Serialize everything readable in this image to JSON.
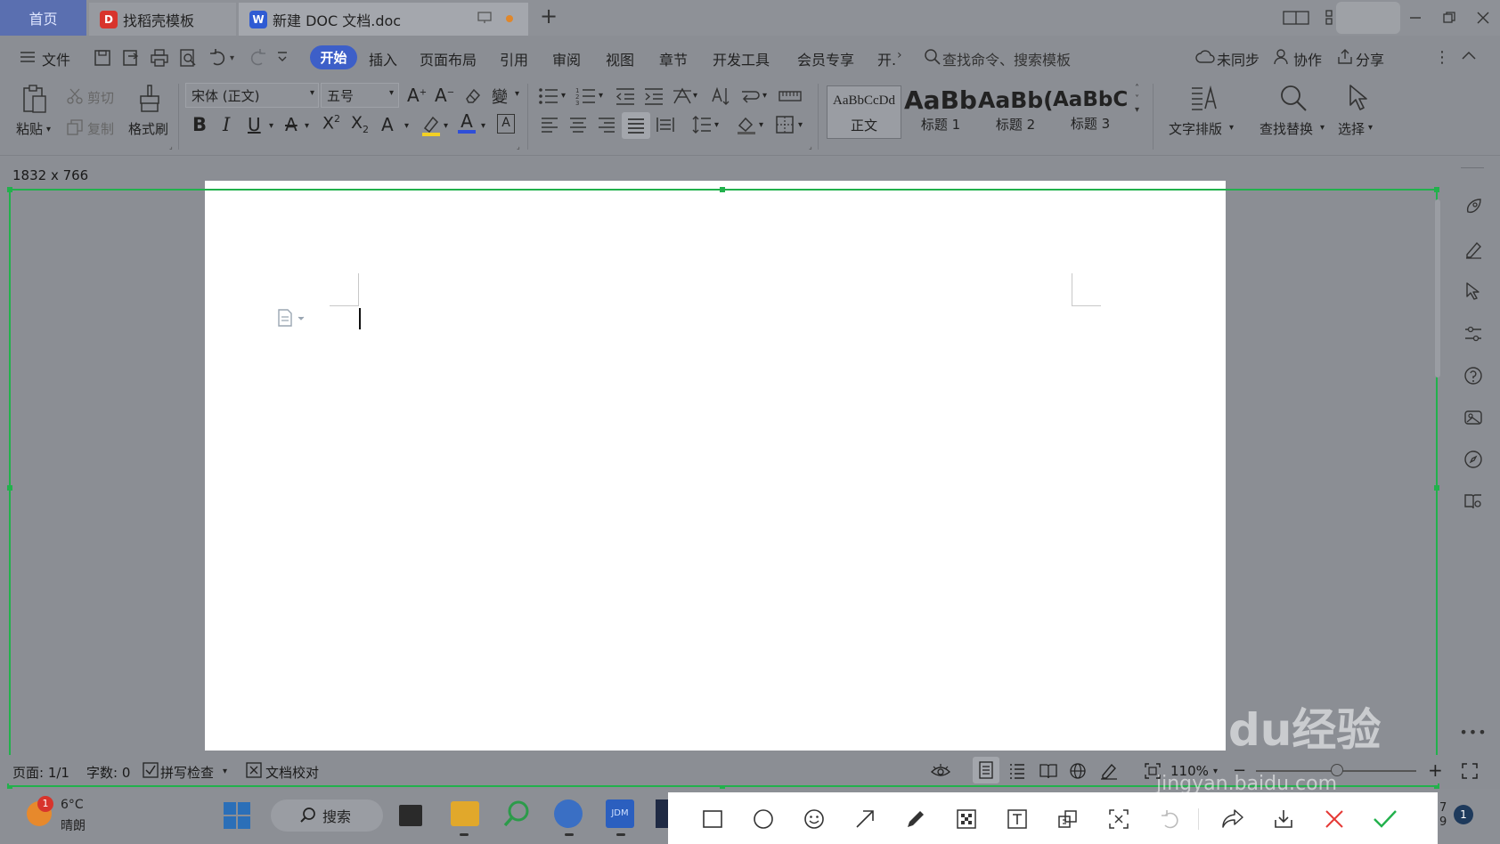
{
  "tabs": {
    "home": "首页",
    "templates": "找稻壳模板",
    "doc": "新建 DOC 文档.doc",
    "new_tab": "+"
  },
  "menu": {
    "file": "文件",
    "items": [
      "开始",
      "插入",
      "页面布局",
      "引用",
      "审阅",
      "视图",
      "章节",
      "开发工具",
      "会员专享",
      "开."
    ],
    "search_placeholder": "查找命令、搜索模板",
    "unsynced": "未同步",
    "collab": "协作",
    "share": "分享"
  },
  "ribbon": {
    "paste": "粘贴",
    "cut": "剪切",
    "copy": "复制",
    "format_painter": "格式刷",
    "font_name": "宋体 (正文)",
    "font_size": "五号",
    "styles": [
      {
        "preview": "AaBbCcDd",
        "label": "正文"
      },
      {
        "preview": "AaBb",
        "label": "标题 1"
      },
      {
        "preview": "AaBb(",
        "label": "标题 2"
      },
      {
        "preview": "AaBbC",
        "label": "标题 3"
      }
    ],
    "text_layout": "文字排版",
    "find_replace": "查找替换",
    "select": "选择"
  },
  "canvas": {
    "size_label": "1832 x 766"
  },
  "status": {
    "page": "页面: 1/1",
    "word_count": "字数: 0",
    "spell_check": "拼写检查",
    "proofread": "文档校对",
    "zoom": "110%"
  },
  "taskbar": {
    "weather_temp": "6°C",
    "weather_desc": "晴朗",
    "weather_badge": "1",
    "search": "搜索",
    "notify_count": "1"
  },
  "watermark": {
    "text": "Baidu经验",
    "url": "jingyan.baidu.com"
  },
  "colors": {
    "accent": "#3d5fc8",
    "selection": "#22b14c",
    "cancel": "#e53935",
    "confirm": "#22b14c"
  }
}
